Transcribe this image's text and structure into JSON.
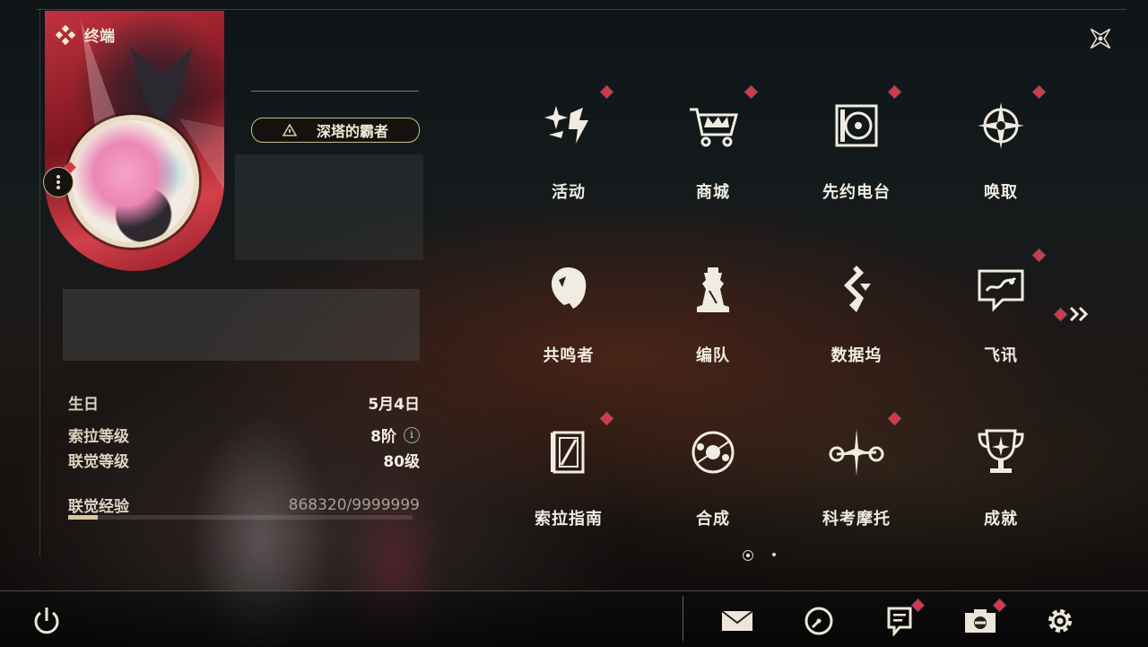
{
  "header": {
    "title": "终端",
    "close_icon": "close-star-icon"
  },
  "profile": {
    "title_badge": "深塔的霸者",
    "stats": [
      {
        "label": "生日",
        "value": "5月4日"
      },
      {
        "label": "索拉等级",
        "value": "8阶"
      },
      {
        "label": "联觉等级",
        "value": "80级"
      },
      {
        "label": "联觉经验",
        "value": "868320/9999999"
      }
    ],
    "exp_progress": 0.087
  },
  "menu": {
    "items": [
      {
        "label": "活动",
        "icon": "sparkle-icon",
        "badge": true
      },
      {
        "label": "商城",
        "icon": "cart-crown-icon",
        "badge": true
      },
      {
        "label": "先约电台",
        "icon": "radio-icon",
        "badge": true
      },
      {
        "label": "唤取",
        "icon": "compass-star-icon",
        "badge": true
      },
      {
        "label": "共鸣者",
        "icon": "resonator-head-icon",
        "badge": false
      },
      {
        "label": "编队",
        "icon": "chess-piece-icon",
        "badge": false
      },
      {
        "label": "数据坞",
        "icon": "data-dock-icon",
        "badge": false
      },
      {
        "label": "飞讯",
        "icon": "chat-bubble-icon",
        "badge": true
      },
      {
        "label": "索拉指南",
        "icon": "guide-book-icon",
        "badge": true
      },
      {
        "label": "合成",
        "icon": "synthesis-icon",
        "badge": false
      },
      {
        "label": "科考摩托",
        "icon": "motorcycle-icon",
        "badge": true
      },
      {
        "label": "成就",
        "icon": "trophy-icon",
        "badge": false
      }
    ],
    "next_page_icon": "double-chevron-right-icon",
    "page_count": 2,
    "current_page": 1
  },
  "bottom_bar": {
    "items": [
      {
        "icon": "power-icon"
      },
      {
        "icon": "mail-icon"
      },
      {
        "icon": "clock-icon"
      },
      {
        "icon": "notice-icon"
      },
      {
        "icon": "camera-icon"
      },
      {
        "icon": "settings-icon"
      }
    ]
  },
  "colors": {
    "accent_gold": "#c9b98f",
    "badge_red": "#d9364b",
    "text": "#ece6d8"
  }
}
